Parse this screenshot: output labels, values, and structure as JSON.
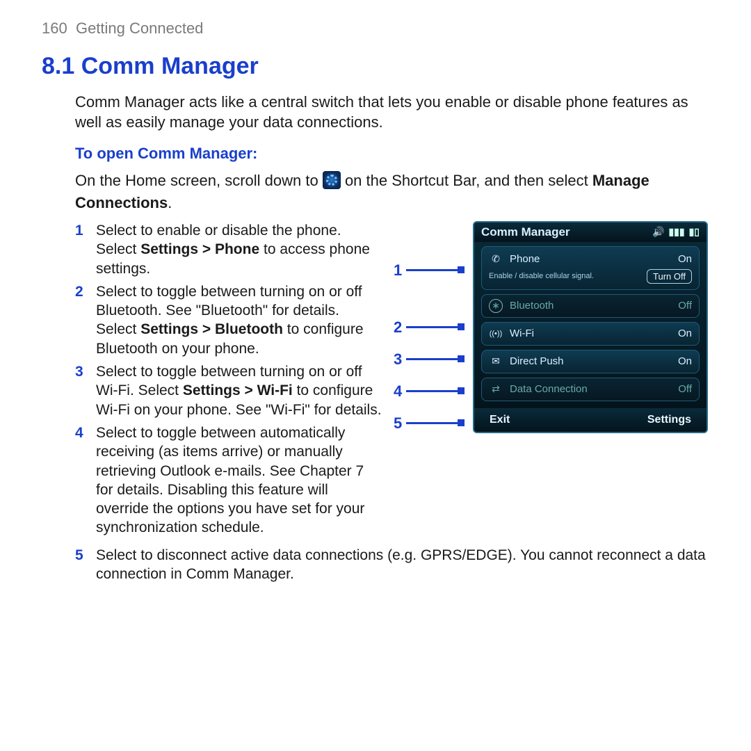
{
  "header": {
    "page_number": "160",
    "chapter": "Getting Connected"
  },
  "title": "8.1  Comm Manager",
  "intro": "Comm Manager acts like a central switch that lets you enable or disable phone features as well as easily manage your data connections.",
  "subhead": "To open Comm Manager:",
  "open_instruction": {
    "pre": "On the Home screen, scroll down to ",
    "post": " on the Shortcut Bar, and then select ",
    "bold_end": "Manage Connections",
    "period": "."
  },
  "list": [
    {
      "n": "1",
      "pre": "Select to enable or disable the phone. Select ",
      "bold": "Settings > Phone",
      "post": " to access phone settings."
    },
    {
      "n": "2",
      "pre": "Select to toggle between turning on or off Bluetooth. See \"Bluetooth\" for details. Select ",
      "bold": "Settings > Bluetooth",
      "post": " to configure Bluetooth on your phone."
    },
    {
      "n": "3",
      "pre": "Select to toggle between turning on or off Wi-Fi. Select ",
      "bold": "Settings > Wi-Fi",
      "post": " to configure Wi-Fi on your phone. See \"Wi-Fi\" for details."
    },
    {
      "n": "4",
      "pre": "Select to toggle between automatically receiving (as items arrive) or manually retrieving Outlook e-mails. See Chapter 7 for details. Disabling this feature will override the options you have set for your synchronization schedule.",
      "bold": "",
      "post": ""
    },
    {
      "n": "5",
      "pre": "Select to disconnect active data connections (e.g. GPRS/EDGE). You cannot reconnect a data connection in Comm Manager.",
      "bold": "",
      "post": ""
    }
  ],
  "phone": {
    "title": "Comm Manager",
    "rows": [
      {
        "icon": "phone-icon",
        "glyph": "✆",
        "label": "Phone",
        "state": "On",
        "dim": false,
        "sub_label": "Enable / disable cellular signal.",
        "toggle": "Turn Off"
      },
      {
        "icon": "bluetooth-icon",
        "glyph": "∗",
        "label": "Bluetooth",
        "state": "Off",
        "dim": true
      },
      {
        "icon": "wifi-icon",
        "glyph": "((•))",
        "label": "Wi-Fi",
        "state": "On",
        "dim": false
      },
      {
        "icon": "mail-icon",
        "glyph": "✉",
        "label": "Direct Push",
        "state": "On",
        "dim": false
      },
      {
        "icon": "data-icon",
        "glyph": "⇄",
        "label": "Data Connection",
        "state": "Off",
        "dim": true
      }
    ],
    "softkeys": {
      "left": "Exit",
      "right": "Settings"
    }
  },
  "callouts": [
    "1",
    "2",
    "3",
    "4",
    "5"
  ]
}
